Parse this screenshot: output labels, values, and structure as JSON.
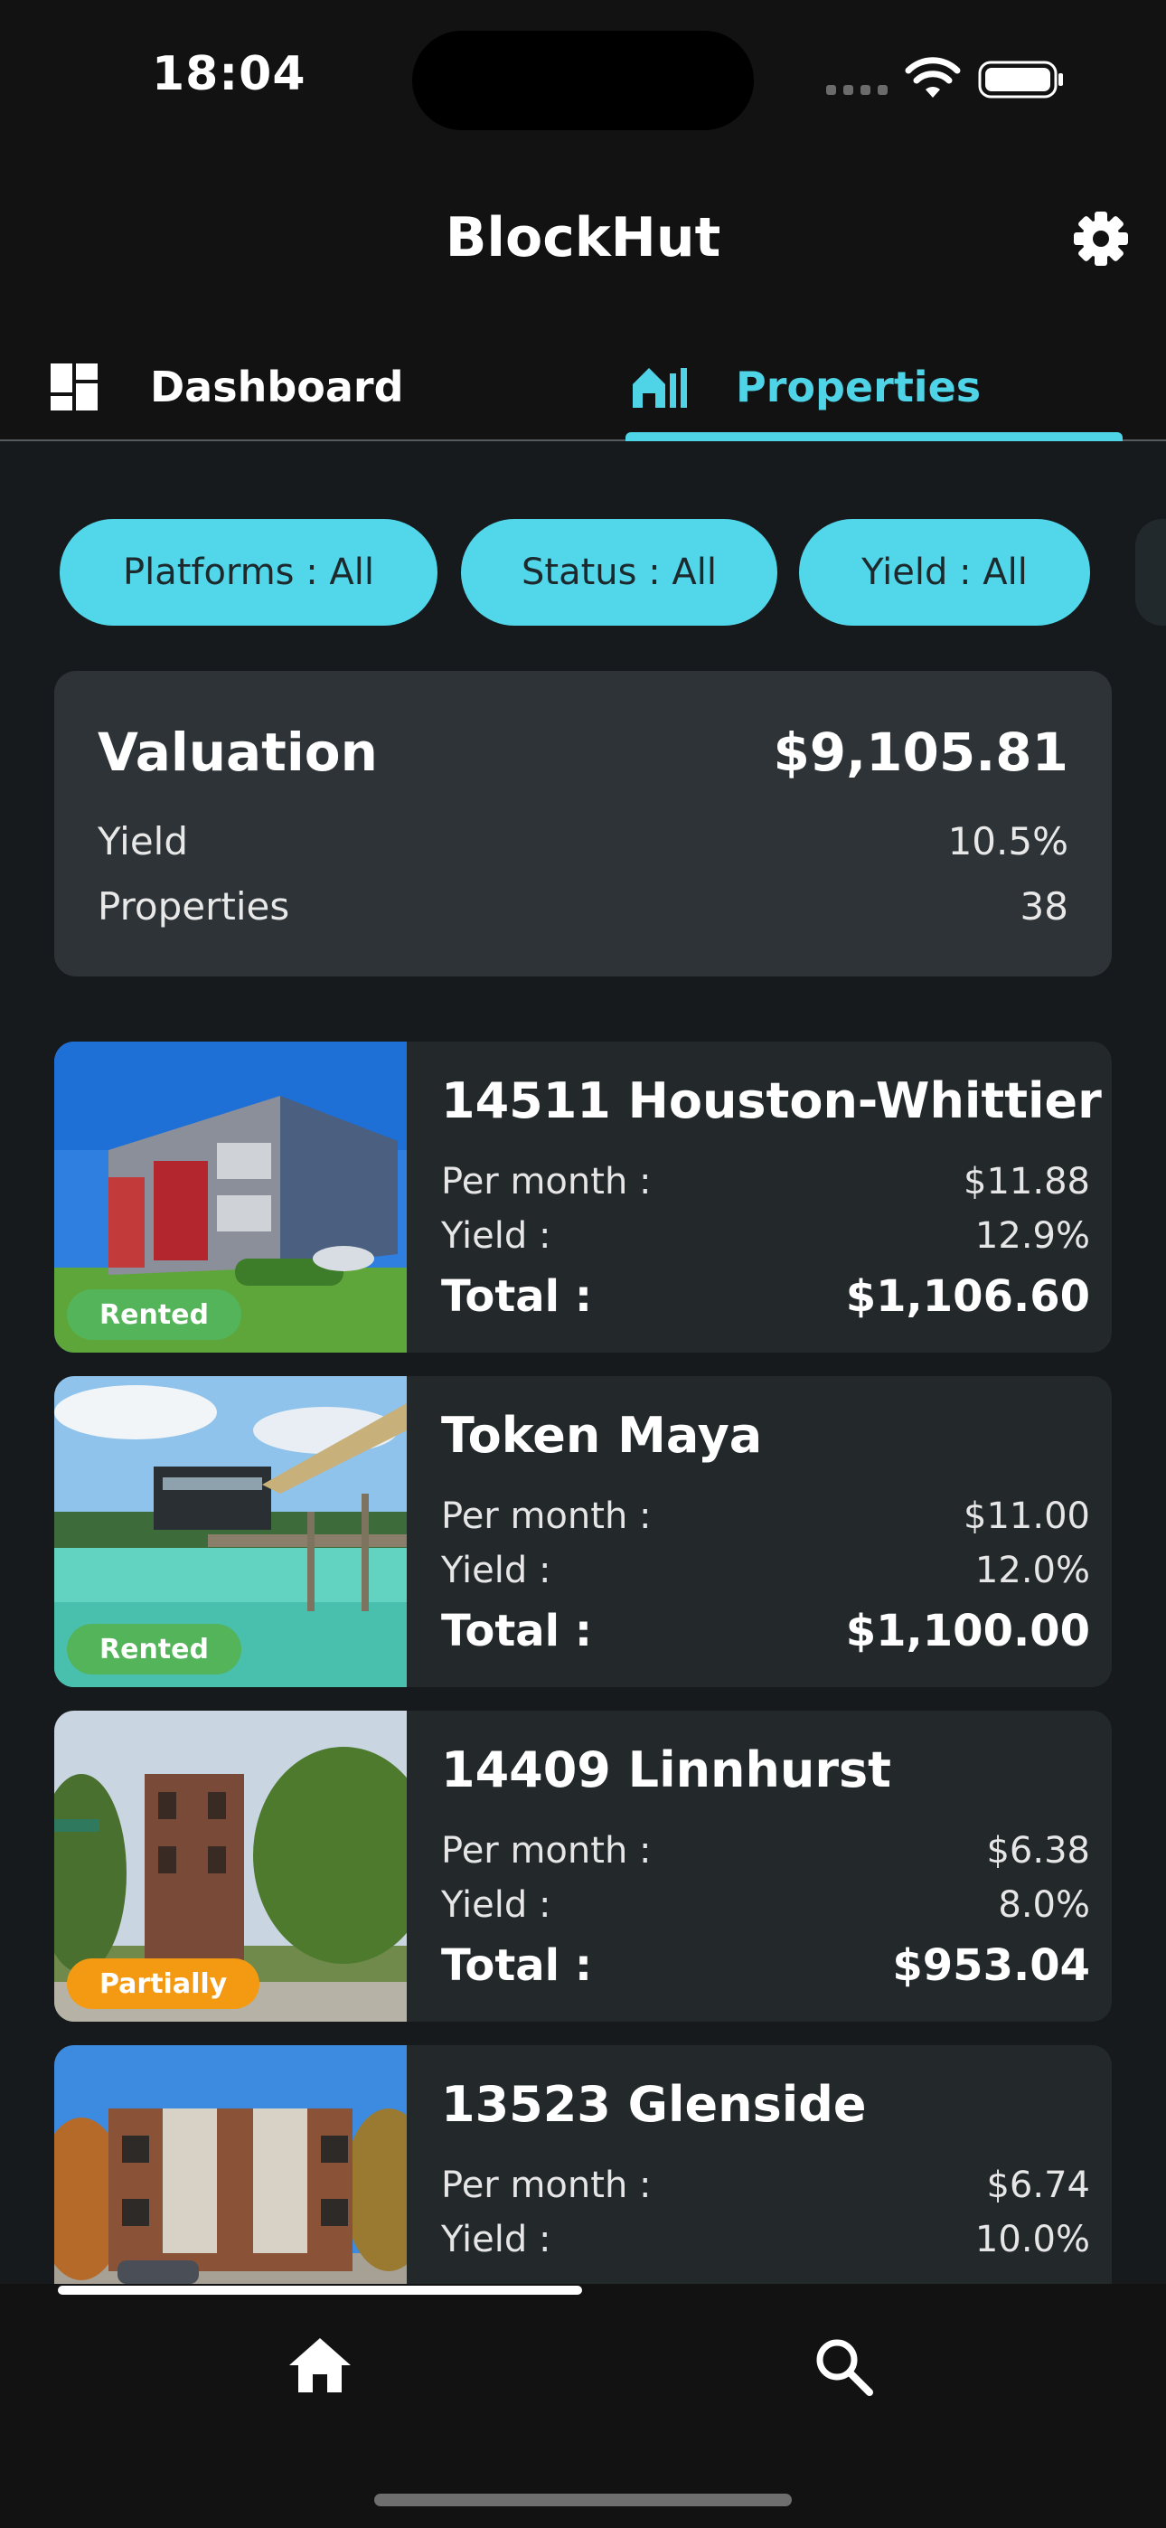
{
  "status_bar": {
    "time": "18:04"
  },
  "app": {
    "title": "BlockHut"
  },
  "tabs": [
    {
      "label": "Dashboard",
      "icon": "dashboard-icon",
      "active": false
    },
    {
      "label": "Properties",
      "icon": "properties-icon",
      "active": true
    }
  ],
  "filters": [
    {
      "label": "Platforms : All"
    },
    {
      "label": "Status : All"
    },
    {
      "label": "Yield : All"
    }
  ],
  "summary": {
    "title": "Valuation",
    "value": "$9,105.81",
    "yield_label": "Yield",
    "yield_value": "10.5%",
    "properties_label": "Properties",
    "properties_value": "38"
  },
  "labels": {
    "per_month": "Per month :",
    "yield": "Yield :",
    "total": "Total :"
  },
  "properties": [
    {
      "name": "14511 Houston-Whittier",
      "status": "Rented",
      "per_month": "$11.88",
      "yield": "12.9%",
      "total": "$1,106.60"
    },
    {
      "name": "Token Maya",
      "status": "Rented",
      "per_month": "$11.00",
      "yield": "12.0%",
      "total": "$1,100.00"
    },
    {
      "name": "14409 Linnhurst",
      "status": "Partially",
      "per_month": "$6.38",
      "yield": "8.0%",
      "total": "$953.04"
    },
    {
      "name": "13523 Glenside",
      "status": "",
      "per_month": "$6.74",
      "yield": "10.0%",
      "total": ""
    }
  ],
  "colors": {
    "accent": "#4fd3e6",
    "rented": "#54b45a",
    "partially": "#f49a12",
    "background": "#171a1c",
    "card": "#23282b"
  },
  "bottom_nav": [
    {
      "icon": "home-icon"
    },
    {
      "icon": "search-icon"
    }
  ]
}
